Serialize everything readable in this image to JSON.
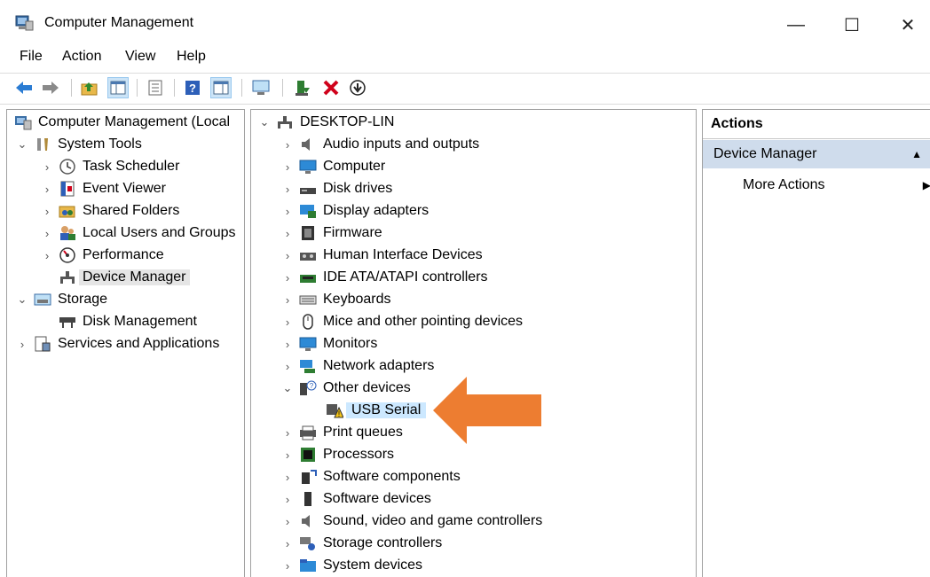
{
  "window": {
    "title": "Computer Management",
    "min": "—",
    "max": "☐",
    "close": "✕"
  },
  "menu": [
    "File",
    "Action",
    "View",
    "Help"
  ],
  "left_tree": {
    "root": "Computer Management (Local",
    "system_tools": "System Tools",
    "task_scheduler": "Task Scheduler",
    "event_viewer": "Event Viewer",
    "shared_folders": "Shared Folders",
    "local_users": "Local Users and Groups",
    "performance": "Performance",
    "device_manager": "Device Manager",
    "storage": "Storage",
    "disk_management": "Disk Management",
    "services": "Services and Applications"
  },
  "device_tree": {
    "computer": "DESKTOP-LIN",
    "categories": [
      "Audio inputs and outputs",
      "Computer",
      "Disk drives",
      "Display adapters",
      "Firmware",
      "Human Interface Devices",
      "IDE ATA/ATAPI controllers",
      "Keyboards",
      "Mice and other pointing devices",
      "Monitors",
      "Network adapters",
      "Other devices",
      "USB Serial",
      "Print queues",
      "Processors",
      "Software components",
      "Software devices",
      "Sound, video and game controllers",
      "Storage controllers",
      "System devices"
    ]
  },
  "actions": {
    "header": "Actions",
    "section": "Device Manager",
    "more": "More Actions"
  },
  "colors": {
    "arrow": "#ed7d31",
    "selected_blue": "#cce8ff",
    "actions_section_bg": "#cfdcec"
  }
}
